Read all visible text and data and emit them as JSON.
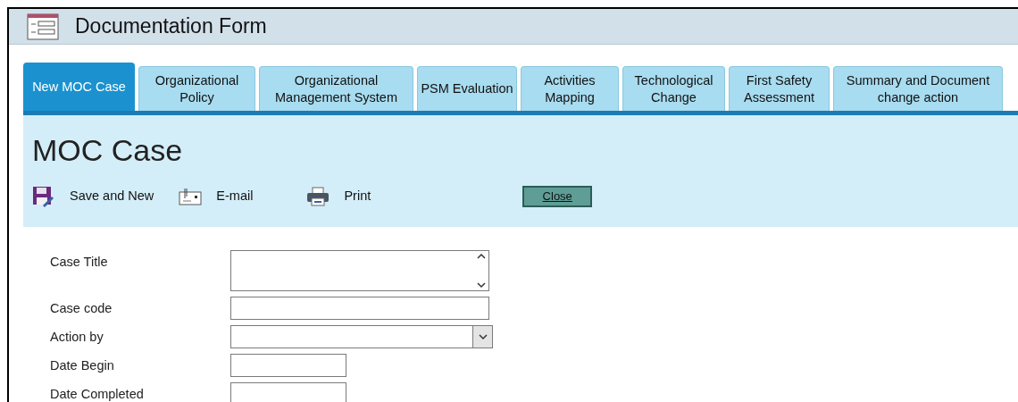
{
  "window": {
    "title": "Documentation Form"
  },
  "tabs": [
    {
      "label": "New MOC Case",
      "selected": true
    },
    {
      "label": "Organizational Policy",
      "selected": false
    },
    {
      "label": "Organizational Management System",
      "selected": false
    },
    {
      "label": "PSM Evaluation",
      "selected": false
    },
    {
      "label": "Activities Mapping",
      "selected": false
    },
    {
      "label": "Technological Change",
      "selected": false
    },
    {
      "label": "First Safety Assessment",
      "selected": false
    },
    {
      "label": "Summary and Document change action",
      "selected": false
    }
  ],
  "form": {
    "heading": "MOC Case",
    "toolbar": [
      {
        "kind": "save",
        "label": "Save and New"
      },
      {
        "kind": "email",
        "label": "E-mail"
      },
      {
        "kind": "print",
        "label": "Print"
      }
    ],
    "close_button": "Close",
    "fields": [
      {
        "kind": "memo",
        "label": "Case Title"
      },
      {
        "kind": "text",
        "label": "Case code"
      },
      {
        "kind": "combo",
        "label": "Action by"
      },
      {
        "kind": "date",
        "label": "Date Begin"
      },
      {
        "kind": "date",
        "label": "Date Completed"
      }
    ]
  }
}
